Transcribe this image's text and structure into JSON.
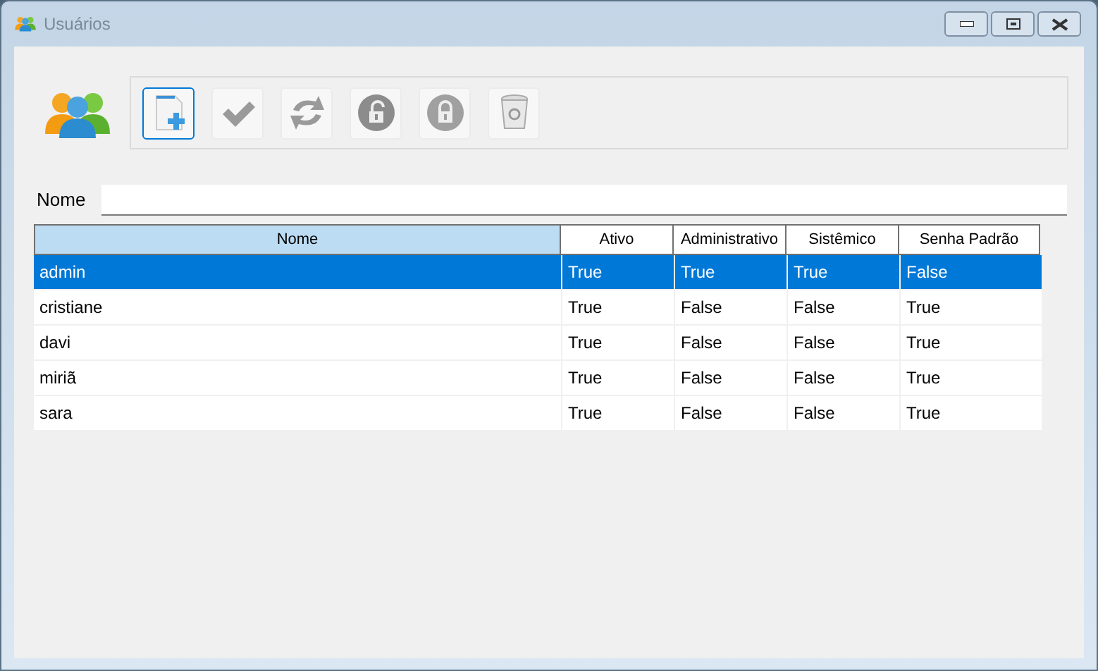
{
  "window": {
    "title": "Usuários"
  },
  "toolbar": [
    {
      "kind": "new",
      "selected": true
    },
    {
      "kind": "confirm",
      "selected": false
    },
    {
      "kind": "refresh",
      "selected": false
    },
    {
      "kind": "unlock",
      "selected": false
    },
    {
      "kind": "lock",
      "selected": false
    },
    {
      "kind": "delete",
      "selected": false
    }
  ],
  "filter": {
    "label": "Nome"
  },
  "table": {
    "columns": [
      "Nome",
      "Ativo",
      "Administrativo",
      "Sistêmico",
      "Senha Padrão"
    ],
    "rows": [
      {
        "cells": [
          "admin",
          "True",
          "True",
          "True",
          "False"
        ],
        "selected": true
      },
      {
        "cells": [
          "cristiane",
          "True",
          "False",
          "False",
          "True"
        ],
        "selected": false
      },
      {
        "cells": [
          "davi",
          "True",
          "False",
          "False",
          "True"
        ],
        "selected": false
      },
      {
        "cells": [
          "miriã",
          "True",
          "False",
          "False",
          "True"
        ],
        "selected": false
      },
      {
        "cells": [
          "sara",
          "True",
          "False",
          "False",
          "True"
        ],
        "selected": false
      }
    ]
  }
}
